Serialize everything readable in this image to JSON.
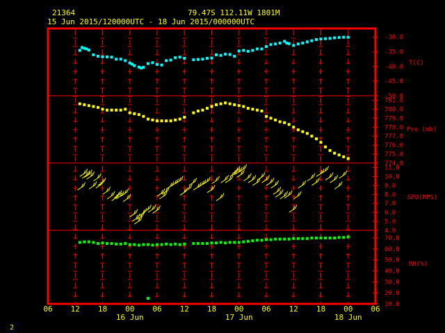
{
  "header": {
    "station_id": "21364",
    "location": "79.47S  112.11W  1801M",
    "time_range": "15 Jun 2015/120000UTC - 18 Jun 2015/000000UTC"
  },
  "footer": {
    "page_number": "2"
  },
  "colors": {
    "background": "#000000",
    "frame": "#ff0000",
    "temperature": "#00ffff",
    "pressure": "#ffff00",
    "wind": "#ffff00",
    "humidity": "#00ff00",
    "text": "#ffff00",
    "axis_text": "#ff0000"
  },
  "chart_data": {
    "type": "scatter",
    "x_unit": "hours since 15 Jun 2015 06 UTC",
    "xlim": [
      0,
      72
    ],
    "x_ticks": [
      {
        "x": 0,
        "label": "06"
      },
      {
        "x": 6,
        "label": "12"
      },
      {
        "x": 12,
        "label": "18"
      },
      {
        "x": 18,
        "label": "00"
      },
      {
        "x": 24,
        "label": "06"
      },
      {
        "x": 30,
        "label": "12"
      },
      {
        "x": 36,
        "label": "18"
      },
      {
        "x": 42,
        "label": "00"
      },
      {
        "x": 48,
        "label": "06"
      },
      {
        "x": 54,
        "label": "12"
      },
      {
        "x": 60,
        "label": "18"
      },
      {
        "x": 66,
        "label": "00"
      },
      {
        "x": 72,
        "label": "06"
      }
    ],
    "date_labels": [
      {
        "x": 18,
        "label": "16 Jun"
      },
      {
        "x": 42,
        "label": "17 Jun"
      },
      {
        "x": 66,
        "label": "18 Jun"
      }
    ],
    "panels": [
      {
        "name": "temperature",
        "label": "T(C)",
        "ylim": [
          -50,
          -27
        ],
        "yticks": [
          {
            "v": -30,
            "label": "-30.0"
          },
          {
            "v": -35,
            "label": "-35.0"
          },
          {
            "v": -40,
            "label": "-40.0"
          },
          {
            "v": -45,
            "label": "-45.0"
          },
          {
            "v": -50,
            "label": "-50.0"
          }
        ],
        "points": [
          [
            7,
            -34.5
          ],
          [
            7.5,
            -33.5
          ],
          [
            8,
            -33.8
          ],
          [
            8.5,
            -34
          ],
          [
            9,
            -34.4
          ],
          [
            10,
            -36
          ],
          [
            11,
            -36.5
          ],
          [
            12,
            -36.7
          ],
          [
            13,
            -36.7
          ],
          [
            14,
            -36.8
          ],
          [
            15,
            -37.5
          ],
          [
            16,
            -37.5
          ],
          [
            17,
            -38
          ],
          [
            18,
            -38.8
          ],
          [
            18.5,
            -39.2
          ],
          [
            19,
            -39.7
          ],
          [
            20,
            -40.2
          ],
          [
            20.5,
            -40.5
          ],
          [
            21,
            -40.3
          ],
          [
            22,
            -39
          ],
          [
            23,
            -38.7
          ],
          [
            24,
            -39.3
          ],
          [
            25,
            -39.5
          ],
          [
            26,
            -38
          ],
          [
            27,
            -37.8
          ],
          [
            28,
            -37
          ],
          [
            29,
            -36.8
          ],
          [
            30,
            -37.2
          ],
          [
            32,
            -37.7
          ],
          [
            33,
            -37.6
          ],
          [
            34,
            -37.5
          ],
          [
            35,
            -37.2
          ],
          [
            36,
            -37.1
          ],
          [
            37,
            -36
          ],
          [
            38,
            -36.2
          ],
          [
            39,
            -35.8
          ],
          [
            40,
            -35.9
          ],
          [
            41,
            -36.5
          ],
          [
            42,
            -34.7
          ],
          [
            43,
            -34.5
          ],
          [
            44,
            -34.8
          ],
          [
            45,
            -34.5
          ],
          [
            46,
            -34
          ],
          [
            47,
            -34
          ],
          [
            48,
            -33.2
          ],
          [
            49,
            -32.5
          ],
          [
            50,
            -32.3
          ],
          [
            51,
            -32
          ],
          [
            52,
            -31.4
          ],
          [
            52.5,
            -32
          ],
          [
            53,
            -32.2
          ],
          [
            54,
            -32.8
          ],
          [
            55,
            -32.3
          ],
          [
            56,
            -32
          ],
          [
            57,
            -31.6
          ],
          [
            58,
            -31.2
          ],
          [
            59,
            -30.8
          ],
          [
            60,
            -30.6
          ],
          [
            61,
            -30.5
          ],
          [
            62,
            -30.4
          ],
          [
            63,
            -30.2
          ],
          [
            64,
            -30.1
          ],
          [
            65,
            -30
          ],
          [
            66,
            -30
          ]
        ]
      },
      {
        "name": "pressure",
        "label": "Pre (mb)",
        "ylim": [
          774,
          781.5
        ],
        "yticks": [
          {
            "v": 781,
            "label": "781.0"
          },
          {
            "v": 780,
            "label": "780.0"
          },
          {
            "v": 779,
            "label": "779.0"
          },
          {
            "v": 778,
            "label": "778.0"
          },
          {
            "v": 777,
            "label": "777.0"
          },
          {
            "v": 776,
            "label": "776.0"
          },
          {
            "v": 775,
            "label": "775.0"
          },
          {
            "v": 774,
            "label": "774.0"
          }
        ],
        "points": [
          [
            7,
            780.6
          ],
          [
            8,
            780.5
          ],
          [
            9,
            780.4
          ],
          [
            10,
            780.3
          ],
          [
            11,
            780.2
          ],
          [
            12,
            780
          ],
          [
            13,
            779.9
          ],
          [
            14,
            779.9
          ],
          [
            15,
            779.9
          ],
          [
            16,
            779.9
          ],
          [
            17,
            780
          ],
          [
            18,
            779.6
          ],
          [
            19,
            779.5
          ],
          [
            20,
            779.4
          ],
          [
            21,
            779.2
          ],
          [
            22,
            778.9
          ],
          [
            23,
            778.8
          ],
          [
            24,
            778.7
          ],
          [
            25,
            778.7
          ],
          [
            26,
            778.7
          ],
          [
            27,
            778.7
          ],
          [
            28,
            778.8
          ],
          [
            29,
            778.9
          ],
          [
            30,
            779.1
          ],
          [
            32,
            779.6
          ],
          [
            33,
            779.8
          ],
          [
            34,
            779.9
          ],
          [
            35,
            780.1
          ],
          [
            36,
            780.3
          ],
          [
            37,
            780.5
          ],
          [
            38,
            780.6
          ],
          [
            39,
            780.7
          ],
          [
            40,
            780.6
          ],
          [
            41,
            780.5
          ],
          [
            42,
            780.4
          ],
          [
            43,
            780.3
          ],
          [
            44,
            780.1
          ],
          [
            45,
            780
          ],
          [
            46,
            779.9
          ],
          [
            47,
            779.8
          ],
          [
            48,
            779.2
          ],
          [
            49,
            779
          ],
          [
            50,
            778.8
          ],
          [
            51,
            778.6
          ],
          [
            52,
            778.5
          ],
          [
            53,
            778.3
          ],
          [
            54,
            778
          ],
          [
            55,
            777.7
          ],
          [
            56,
            777.5
          ],
          [
            57,
            777.3
          ],
          [
            58,
            777
          ],
          [
            59,
            776.7
          ],
          [
            60,
            776.3
          ],
          [
            61,
            775.8
          ],
          [
            62,
            775.4
          ],
          [
            63,
            775.1
          ],
          [
            64,
            774.9
          ],
          [
            65,
            774.7
          ],
          [
            66,
            774.5
          ]
        ]
      },
      {
        "name": "wind",
        "label": "SPD(MPS)",
        "ylim": [
          4,
          11.5
        ],
        "yticks": [
          {
            "v": 11,
            "label": "11.0"
          },
          {
            "v": 10,
            "label": "10.0"
          },
          {
            "v": 9,
            "label": "9.0"
          },
          {
            "v": 8,
            "label": "8.0"
          },
          {
            "v": 7,
            "label": "7.0"
          },
          {
            "v": 6,
            "label": "6.0"
          },
          {
            "v": 5,
            "label": "5.0"
          },
          {
            "v": 4,
            "label": "4.0"
          }
        ],
        "points": [
          [
            6.5,
            8.5
          ],
          [
            7,
            10
          ],
          [
            7.5,
            9.8
          ],
          [
            8,
            9.9
          ],
          [
            8.5,
            9.7
          ],
          [
            9,
            8.6
          ],
          [
            10,
            9.5
          ],
          [
            10.5,
            8.7
          ],
          [
            11,
            9
          ],
          [
            12,
            8
          ],
          [
            13,
            7.5
          ],
          [
            14,
            7.3
          ],
          [
            14.5,
            7.6
          ],
          [
            15,
            7.5
          ],
          [
            16,
            7.8
          ],
          [
            16.5,
            7.2
          ],
          [
            18,
            5.5
          ],
          [
            18.5,
            5
          ],
          [
            19,
            4.7
          ],
          [
            19.5,
            5.2
          ],
          [
            20,
            5.6
          ],
          [
            21,
            6
          ],
          [
            22,
            6
          ],
          [
            23,
            5.9
          ],
          [
            24,
            7.8
          ],
          [
            24.5,
            7.5
          ],
          [
            25,
            8
          ],
          [
            26,
            8.6
          ],
          [
            27,
            8.9
          ],
          [
            28,
            9.2
          ],
          [
            29,
            7.9
          ],
          [
            30,
            8.3
          ],
          [
            31,
            9
          ],
          [
            32,
            8.5
          ],
          [
            33,
            8.8
          ],
          [
            34,
            9.1
          ],
          [
            35,
            8.2
          ],
          [
            36,
            9.2
          ],
          [
            37,
            7.3
          ],
          [
            38,
            9.3
          ],
          [
            39,
            9.3
          ],
          [
            40,
            10
          ],
          [
            40.5,
            10.3
          ],
          [
            41,
            10.2
          ],
          [
            41.5,
            9.9
          ],
          [
            42,
            10.5
          ],
          [
            43,
            9.5
          ],
          [
            44,
            9.3
          ],
          [
            45,
            9
          ],
          [
            46,
            9.6
          ],
          [
            47,
            9.3
          ],
          [
            48,
            9
          ],
          [
            49,
            8.7
          ],
          [
            49.5,
            8
          ],
          [
            50,
            7.7
          ],
          [
            51,
            7.5
          ],
          [
            52,
            7.6
          ],
          [
            53,
            6
          ],
          [
            54,
            7.5
          ],
          [
            55,
            8.7
          ],
          [
            57,
            9.5
          ],
          [
            58,
            9
          ],
          [
            59,
            10
          ],
          [
            60,
            10.3
          ],
          [
            61,
            9.6
          ],
          [
            62,
            9.3
          ],
          [
            63,
            8.6
          ],
          [
            64,
            9.8
          ]
        ]
      },
      {
        "name": "humidity",
        "label": "RH(%)",
        "ylim": [
          10,
          77
        ],
        "yticks": [
          {
            "v": 70,
            "label": "70.0"
          },
          {
            "v": 60,
            "label": "60.0"
          },
          {
            "v": 50,
            "label": "50.0"
          },
          {
            "v": 40,
            "label": "40.0"
          },
          {
            "v": 30,
            "label": "30.0"
          },
          {
            "v": 20,
            "label": "20.0"
          },
          {
            "v": 10,
            "label": "10.0"
          }
        ],
        "points": [
          [
            7,
            66
          ],
          [
            8,
            66.5
          ],
          [
            9,
            66.5
          ],
          [
            10,
            66
          ],
          [
            11,
            65
          ],
          [
            12,
            65.5
          ],
          [
            13,
            65
          ],
          [
            14,
            65
          ],
          [
            15,
            64.5
          ],
          [
            16,
            64.5
          ],
          [
            17,
            65
          ],
          [
            18,
            64
          ],
          [
            19,
            64
          ],
          [
            20,
            63.5
          ],
          [
            21,
            64
          ],
          [
            22,
            64
          ],
          [
            23,
            63.5
          ],
          [
            24,
            64
          ],
          [
            25,
            64
          ],
          [
            26,
            64.5
          ],
          [
            27,
            64
          ],
          [
            28,
            64.5
          ],
          [
            29,
            64
          ],
          [
            30,
            64.5
          ],
          [
            32,
            65
          ],
          [
            33,
            65
          ],
          [
            34,
            65
          ],
          [
            35,
            65
          ],
          [
            36,
            65.5
          ],
          [
            37,
            65.5
          ],
          [
            38,
            66
          ],
          [
            39,
            65.5
          ],
          [
            40,
            66
          ],
          [
            41,
            66
          ],
          [
            42,
            66
          ],
          [
            43,
            66.5
          ],
          [
            44,
            67
          ],
          [
            45,
            67.5
          ],
          [
            46,
            68
          ],
          [
            47,
            68
          ],
          [
            48,
            68.5
          ],
          [
            49,
            68.5
          ],
          [
            50,
            69
          ],
          [
            51,
            69
          ],
          [
            52,
            69
          ],
          [
            53,
            69
          ],
          [
            54,
            69.5
          ],
          [
            55,
            69.5
          ],
          [
            56,
            69.5
          ],
          [
            57,
            69.5
          ],
          [
            58,
            70
          ],
          [
            59,
            70
          ],
          [
            60,
            70
          ],
          [
            61,
            70
          ],
          [
            62,
            70
          ],
          [
            63,
            70
          ],
          [
            64,
            70.5
          ],
          [
            65,
            70.5
          ],
          [
            66,
            71
          ],
          [
            22,
            15
          ]
        ]
      }
    ]
  }
}
